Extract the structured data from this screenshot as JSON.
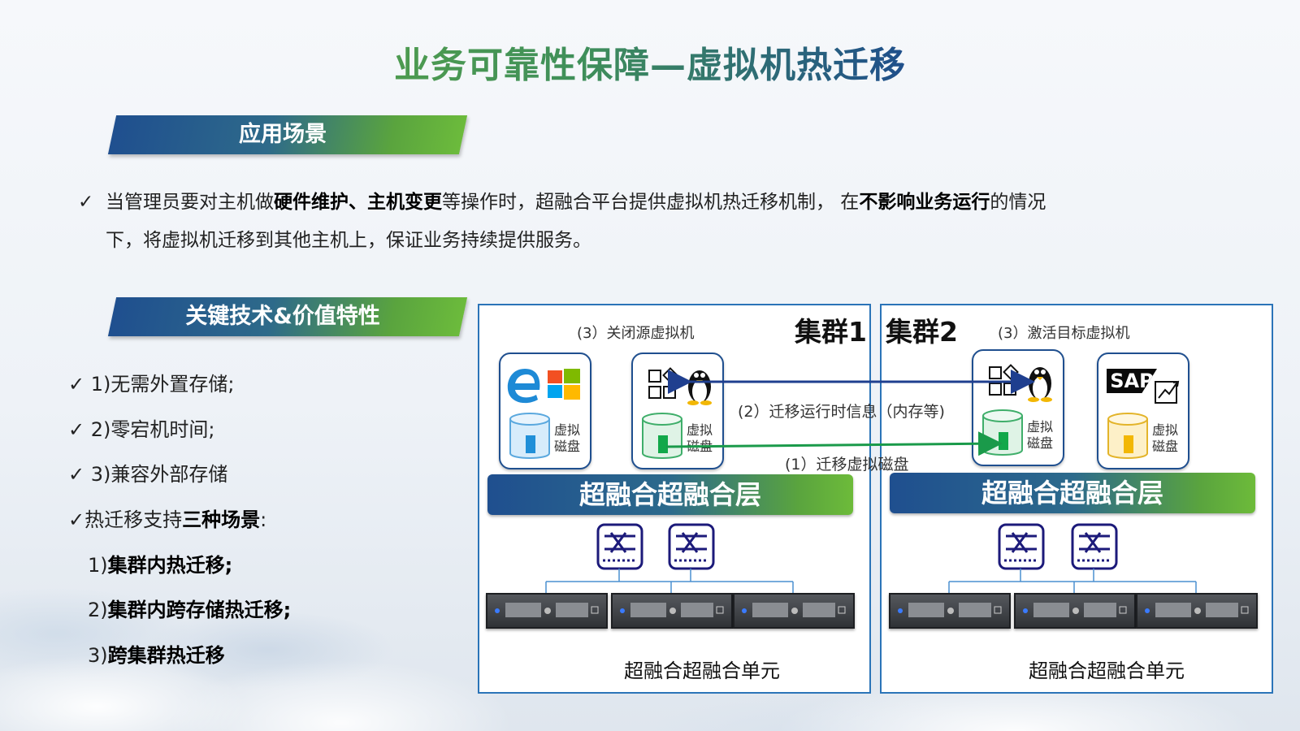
{
  "title": "业务可靠性保障—虚拟机热迁移",
  "section1": {
    "banner": "应用场景",
    "line1_parts": [
      "当管理员要对主机做",
      "硬件维护、主机变更",
      "等操作时，超融合平台提供虚拟机热迁移机制， 在",
      "不影响业务运行",
      "的情况"
    ],
    "line2": "下，将虚拟机迁移到其他主机上，保证业务持续提供服务。",
    "check": "✓"
  },
  "section2": {
    "banner": "关键技术&价值特性",
    "features": [
      "✓ 1)无需外置存储;",
      "✓ 2)零宕机时间;",
      "✓ 3)兼容外部存储"
    ],
    "support_prefix": "✓热迁移支持",
    "support_bold": "三种场景",
    "support_suffix": ":",
    "scenarios": [
      {
        "num": "1)",
        "text": "集群内热迁移;"
      },
      {
        "num": "2)",
        "text": "集群内跨存储热迁移;"
      },
      {
        "num": "3)",
        "text": "跨集群热迁移"
      }
    ]
  },
  "diagram": {
    "cluster1": {
      "title": "集群1",
      "step3": "(3）关闭源虚拟机",
      "layer": "超融合超融合层",
      "unit": "超融合超融合单元"
    },
    "cluster2": {
      "title": "集群2",
      "step3": "(3）激活目标虚拟机",
      "layer": "超融合超融合层",
      "unit": "超融合超融合单元"
    },
    "step2": "(2）迁移运行时信息（内存等)",
    "step1": "(1）迁移虚拟磁盘",
    "disk_label": "虚拟磁盘",
    "sap_logo": "SAP",
    "colors": {
      "arrow_memory": "#1f3f8f",
      "arrow_disk": "#1a9a4a",
      "disk_blue": "#1f8fd8",
      "disk_green": "#12a84a",
      "disk_yellow": "#f2b705",
      "border": "#2b74b8"
    }
  }
}
